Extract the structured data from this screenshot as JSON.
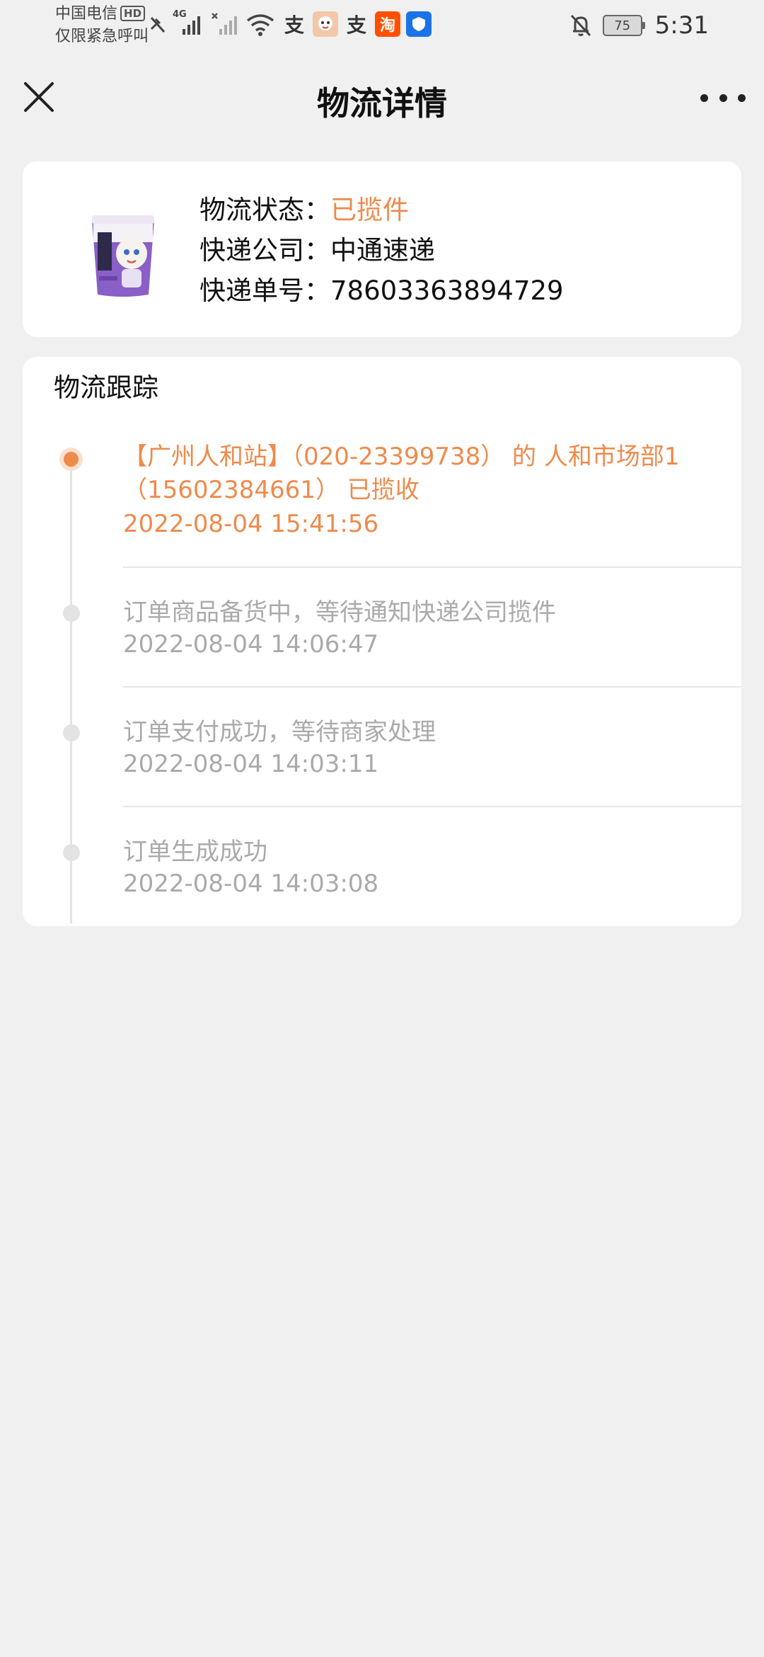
{
  "status_bar": {
    "carrier_line1": "中国电信",
    "carrier_hd": "HD",
    "carrier_line2": "仅限紧急呼叫",
    "network_label": "4G",
    "alipay_glyph": "支",
    "taobao_glyph": "淘",
    "battery_level": "75",
    "time": "5:31",
    "icons": [
      "no-call-icon",
      "signal-icon",
      "no-signal-icon",
      "wifi-icon",
      "alipay-icon",
      "app-avatar-icon",
      "alipay-icon",
      "taobao-icon",
      "shield-app-icon",
      "bell-mute-icon",
      "battery-icon"
    ]
  },
  "header": {
    "title": "物流详情"
  },
  "info": {
    "status_label": "物流状态：",
    "status_value": "已揽件",
    "company_label": "快递公司：",
    "company_value": "中通速递",
    "tracking_label": "快递单号：",
    "tracking_value": "78603363894729"
  },
  "tracking": {
    "title": "物流跟踪",
    "events": [
      {
        "text": "【广州人和站】（020-23399738） 的 人和市场部1（15602384661） 已揽收",
        "time": "2022-08-04 15:41:56",
        "active": true
      },
      {
        "text": "订单商品备货中，等待通知快递公司揽件",
        "time": "2022-08-04 14:06:47",
        "active": false
      },
      {
        "text": "订单支付成功，等待商家处理",
        "time": "2022-08-04 14:03:11",
        "active": false
      },
      {
        "text": "订单生成成功",
        "time": "2022-08-04 14:03:08",
        "active": false
      }
    ]
  },
  "colors": {
    "accent": "#ef8a4b",
    "background": "#f0f0f0",
    "muted_text": "#aaaaaa"
  }
}
